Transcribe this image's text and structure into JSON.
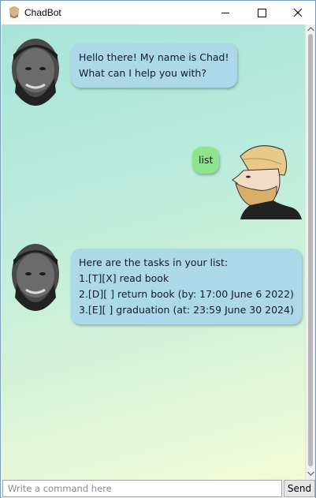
{
  "window": {
    "title": "ChadBot"
  },
  "messages": [
    {
      "sender": "bot",
      "lines": [
        "Hello there! My name is Chad!",
        "What can I help you with?"
      ]
    },
    {
      "sender": "user",
      "lines": [
        "list"
      ]
    },
    {
      "sender": "bot",
      "lines": [
        "Here are the tasks in your list:",
        "1.[T][X] read book",
        "2.[D][ ] return book (by: 17:00 June 6 2022)",
        "3.[E][ ] graduation (at: 23:59 June 30 2024)"
      ]
    }
  ],
  "input": {
    "placeholder": "Write a command here",
    "value": ""
  },
  "send_button": {
    "label": "Send"
  },
  "colors": {
    "bot_bubble": "#acd9ea",
    "user_bubble": "#8fe38c",
    "chat_gradient_top": "#a8e4d8",
    "chat_gradient_bottom": "#f4fbd6"
  },
  "icons": {
    "app": "chad-face-icon",
    "minimize": "minimize-icon",
    "maximize": "maximize-icon",
    "close": "close-icon",
    "bot_avatar": "chad-avatar",
    "user_avatar": "yes-chad-avatar"
  }
}
